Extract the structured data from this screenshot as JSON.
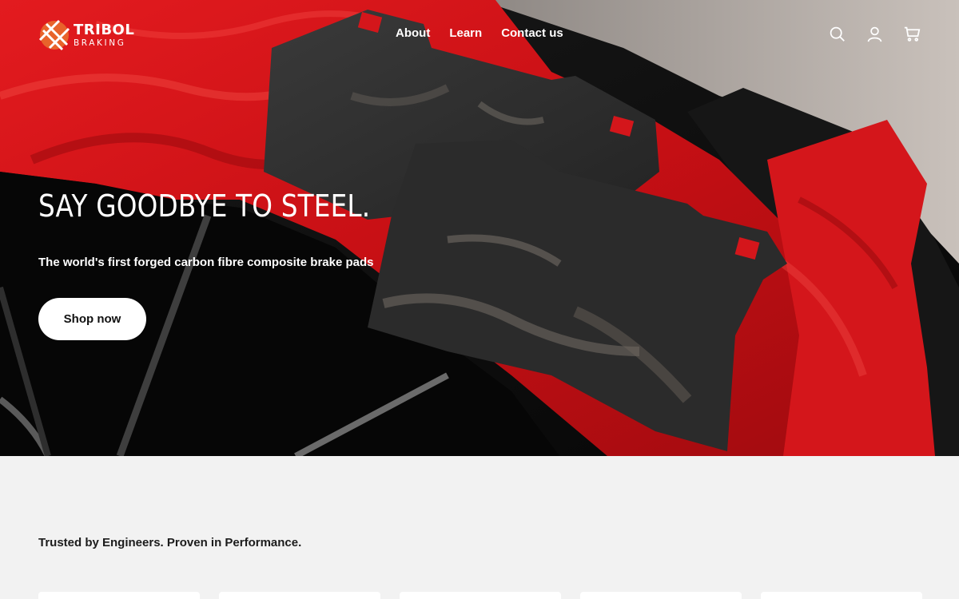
{
  "brand": {
    "name": "TRIBOL",
    "tagline": "BRAKING"
  },
  "nav": {
    "items": [
      "About",
      "Learn",
      "Contact us"
    ]
  },
  "header_icons": [
    "search-icon",
    "account-icon",
    "cart-icon"
  ],
  "hero": {
    "title": "SAY GOODBYE TO STEEL.",
    "subtitle": "The world's first forged carbon fibre composite brake pads",
    "cta": "Shop now"
  },
  "trusted": {
    "heading": "Trusted by Engineers. Proven in Performance."
  },
  "colors": {
    "accent": "#e8632b",
    "hero_red": "#d8131a",
    "background": "#f2f2f2"
  }
}
